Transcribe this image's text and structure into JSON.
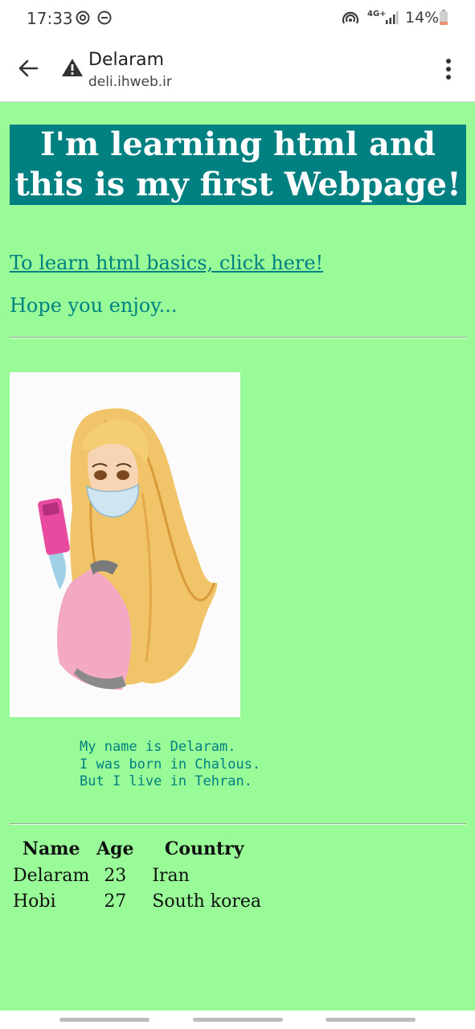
{
  "status_bar": {
    "time": "17:33",
    "network": "4G+",
    "battery": "14%",
    "icons": [
      "sync-icon",
      "dnd-icon",
      "hotspot-icon",
      "network-4g-icon",
      "signal-icon",
      "battery-icon"
    ]
  },
  "browser": {
    "title": "Delaram",
    "url": "deli.ihweb.ir",
    "icons": [
      "back-arrow-icon",
      "warning-icon",
      "more-vert-icon"
    ]
  },
  "page": {
    "heading_line1": "I'm learning html and",
    "heading_line2": "this is my first Webpage!",
    "link_text": "To learn html basics, click here!",
    "hope_text": "Hope you enjoy...",
    "image_alt": "anime girl with phone and mask",
    "pre_lines": [
      "My name is Delaram.",
      "I was born in Chalous.",
      "But I live in Tehran."
    ],
    "table": {
      "headers": [
        "Name",
        "Age",
        "Country"
      ],
      "rows": [
        [
          "Delaram",
          "23",
          "Iran"
        ],
        [
          "Hobi",
          "27",
          "South korea"
        ]
      ]
    }
  },
  "colors": {
    "page_bg": "#98fb98",
    "heading_bg": "#008080",
    "accent_text": "#008080"
  }
}
